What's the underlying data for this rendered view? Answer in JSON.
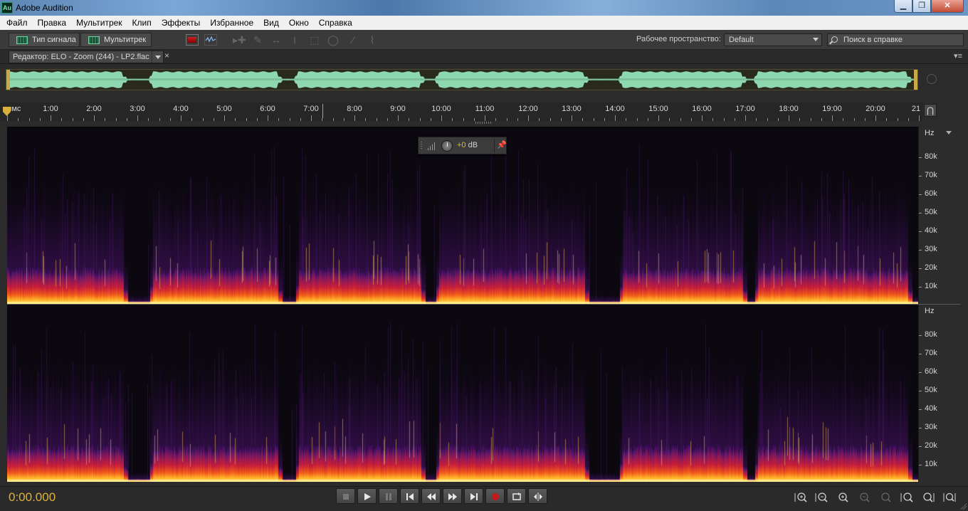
{
  "window": {
    "title": "Adobe Audition",
    "logo": "Au",
    "minimize_icon": "minimize-icon",
    "maximize_icon": "maximize-icon",
    "close_icon": "close-icon"
  },
  "menu": [
    "Файл",
    "Правка",
    "Мультитрек",
    "Клип",
    "Эффекты",
    "Избранное",
    "Вид",
    "Окно",
    "Справка"
  ],
  "toolbar": {
    "waveform_button": "Тип сигнала",
    "multitrack_button": "Мультитрек",
    "workspace_label": "Рабочее пространство:",
    "workspace_value": "Default",
    "search_placeholder": "Поиск в справке"
  },
  "editor": {
    "tab_title": "Редактор: ELO - Zoom (244) - LP2.flac",
    "close_symbol": "×",
    "panel_menu": "▾≡"
  },
  "timeline": {
    "start_label": "чмс",
    "labels": [
      "1:00",
      "2:00",
      "3:00",
      "4:00",
      "5:00",
      "6:00",
      "7:00",
      "8:00",
      "9:00",
      "10:00",
      "11:00",
      "12:00",
      "13:00",
      "14:00",
      "15:00",
      "16:00",
      "17:00",
      "18:00",
      "19:00",
      "20:00",
      "21"
    ],
    "snap_icon": "magnet-icon"
  },
  "spectrum": {
    "unit": "Hz",
    "labels": [
      "80k",
      "70k",
      "60k",
      "50k",
      "40k",
      "30k",
      "20k",
      "10k"
    ]
  },
  "hud": {
    "value": "+0",
    "unit": "dB"
  },
  "transport": {
    "timecode": "0:00.000",
    "buttons": [
      "stop-icon",
      "play-icon",
      "pause-icon",
      "go-to-start-icon",
      "rewind-icon",
      "fast-forward-icon",
      "go-to-end-icon",
      "record-icon",
      "loop-icon",
      "skip-selection-icon"
    ]
  },
  "zoom": [
    "zoom-in-amplitude-icon",
    "zoom-out-amplitude-icon",
    "zoom-in-time-icon",
    "zoom-out-time-icon",
    "zoom-full-icon",
    "zoom-in-start-icon",
    "zoom-in-end-icon",
    "zoom-selection-icon"
  ],
  "colors": {
    "accent": "#e0b23a",
    "spectrogram_low": "#1a0a24",
    "spectrogram_mid": "#c41a3a",
    "spectrogram_high": "#ffd23a",
    "overview_wave": "#8ed8b0"
  }
}
